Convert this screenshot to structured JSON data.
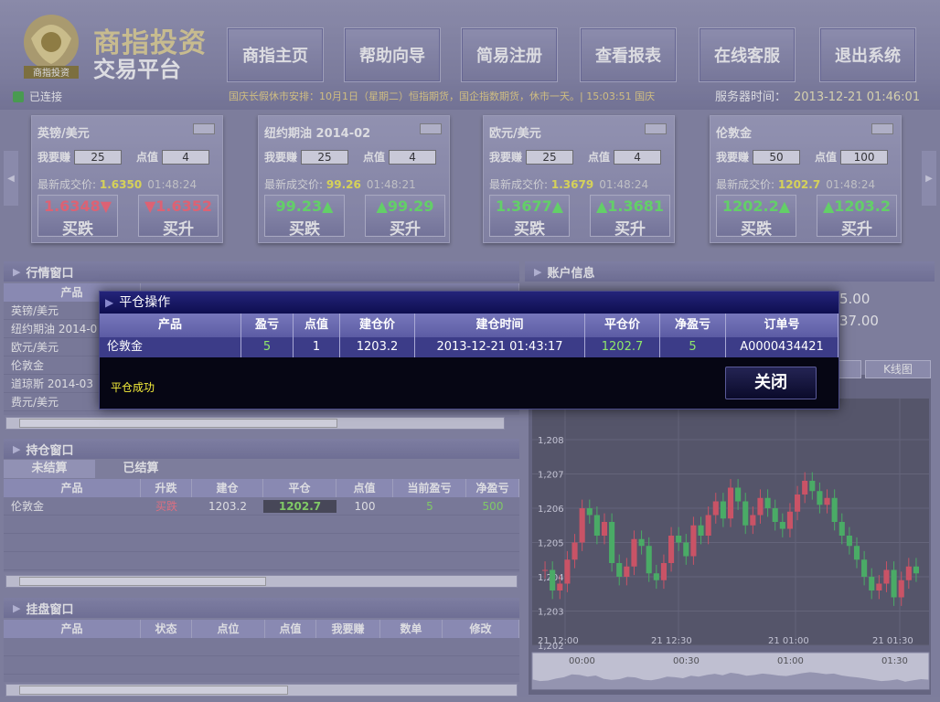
{
  "brand": {
    "name": "商指投资",
    "sub": "交易平台",
    "logo_text": "商指投资"
  },
  "nav": [
    {
      "label": "商指主页"
    },
    {
      "label": "帮助向导"
    },
    {
      "label": "简易注册"
    },
    {
      "label": "查看报表"
    },
    {
      "label": "在线客服"
    },
    {
      "label": "退出系统"
    }
  ],
  "status": {
    "connected": "已连接",
    "ticker": "国庆长假休市安排：10月1日（星期二）恒指期货，国企指数期货，休市一天。| 15:03:51 国庆",
    "server_label": "服务器时间：",
    "server_time": "2013-12-21 01:46:01"
  },
  "quotes": [
    {
      "name": "英镑/美元",
      "lot_label": "我要赚",
      "lot": "25",
      "pt_label": "点值",
      "pt": "4",
      "last_label": "最新成交价:",
      "last": "1.6350",
      "time": "01:48:24",
      "sell_price": "1.6348▼",
      "sell_label": "买跌",
      "buy_price": "▼1.6352",
      "buy_label": "买升",
      "sell_dir": "down",
      "buy_dir": "down"
    },
    {
      "name": "纽约期油 2014-02",
      "lot_label": "我要赚",
      "lot": "25",
      "pt_label": "点值",
      "pt": "4",
      "last_label": "最新成交价:",
      "last": "99.26",
      "time": "01:48:21",
      "sell_price": "99.23▲",
      "sell_label": "买跌",
      "buy_price": "▲99.29",
      "buy_label": "买升",
      "sell_dir": "up",
      "buy_dir": "up"
    },
    {
      "name": "欧元/美元",
      "lot_label": "我要赚",
      "lot": "25",
      "pt_label": "点值",
      "pt": "4",
      "last_label": "最新成交价:",
      "last": "1.3679",
      "time": "01:48:24",
      "sell_price": "1.3677▲",
      "sell_label": "买跌",
      "buy_price": "▲1.3681",
      "buy_label": "买升",
      "sell_dir": "up",
      "buy_dir": "up"
    },
    {
      "name": "伦敦金",
      "lot_label": "我要赚",
      "lot": "50",
      "pt_label": "点值",
      "pt": "100",
      "last_label": "最新成交价:",
      "last": "1202.7",
      "time": "01:48:24",
      "sell_price": "1202.2▲",
      "sell_label": "买跌",
      "buy_price": "▲1203.2",
      "buy_label": "买升",
      "sell_dir": "up",
      "buy_dir": "up"
    }
  ],
  "market_panel": {
    "title": "行情窗口",
    "col_product": "产品",
    "rows": [
      "英镑/美元",
      "纽约期油 2014-0",
      "欧元/美元",
      "伦敦金",
      "道琼斯 2014-03",
      "费元/美元"
    ]
  },
  "account_panel": {
    "title": "账户信息",
    "v1": "5.00",
    "v2": "37.00",
    "kline": "K线图"
  },
  "position_panel": {
    "title": "持仓窗口",
    "tabs": [
      "未结算",
      "已结算"
    ],
    "headers": [
      "产品",
      "升跌",
      "建仓",
      "平仓",
      "点值",
      "当前盈亏",
      "净盈亏"
    ],
    "row": [
      "伦敦金",
      "买跌",
      "1203.2",
      "1202.7",
      "100",
      "5",
      "500"
    ]
  },
  "pending_panel": {
    "title": "挂盘窗口",
    "headers": [
      "产品",
      "状态",
      "点位",
      "点值",
      "我要赚",
      "数单",
      "修改"
    ]
  },
  "modal": {
    "title": "平仓操作",
    "headers": [
      "产品",
      "盈亏",
      "点值",
      "建仓价",
      "建仓时间",
      "平仓价",
      "净盈亏",
      "订单号"
    ],
    "row": [
      "伦敦金",
      "5",
      "1",
      "1203.2",
      "2013-12-21 01:43:17",
      "1202.7",
      "5",
      "A0000434421"
    ],
    "message": "平仓成功",
    "close_label": "关闭"
  },
  "chart_data": {
    "type": "candlestick",
    "y_ticks": [
      "1,208",
      "1,207",
      "1,206",
      "1,205",
      "1,204",
      "1,203",
      "1,202"
    ],
    "x_ticks": [
      "21 12:00",
      "21 12:30",
      "21 01:00",
      "21 01:30"
    ],
    "nav_ticks": [
      "00:00",
      "00:30",
      "01:00",
      "01:30"
    ],
    "ylim": [
      1202,
      1209.2
    ],
    "series": [
      1204.2,
      1203.6,
      1203.8,
      1204.5,
      1205.0,
      1206.0,
      1205.8,
      1205.2,
      1205.6,
      1204.4,
      1204.0,
      1204.3,
      1205.1,
      1204.9,
      1204.1,
      1203.9,
      1204.4,
      1205.2,
      1205.0,
      1204.6,
      1205.5,
      1205.2,
      1205.8,
      1206.2,
      1205.7,
      1206.6,
      1206.2,
      1205.5,
      1205.8,
      1206.3,
      1206.0,
      1205.6,
      1205.4,
      1205.9,
      1206.4,
      1206.8,
      1206.5,
      1206.1,
      1206.3,
      1205.6,
      1205.2,
      1204.9,
      1204.5,
      1204.0,
      1203.6,
      1203.8,
      1204.2,
      1203.4,
      1203.9,
      1204.3,
      1204.1
    ]
  }
}
